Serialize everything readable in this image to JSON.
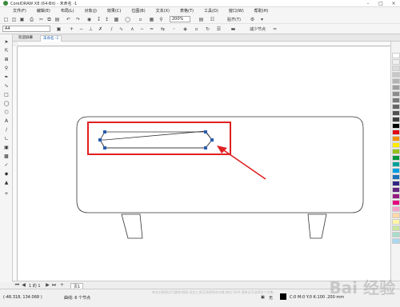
{
  "window": {
    "title": "CorelDRAW X8 (64-Bit) - 未命名 -1"
  },
  "menu": [
    "文件(F)",
    "编辑(E)",
    "布局(L)",
    "对象(J)",
    "效果(C)",
    "位图(B)",
    "文本(X)",
    "表格(T)",
    "工具(O)",
    "窗口(W)",
    "帮助(H)"
  ],
  "toolbar": {
    "zoom_value": "200%",
    "snap_label": "贴齐(T)",
    "font_value": "A4",
    "reduce_nodes_label": "减少节点"
  },
  "tabs": [
    "欢迎屏幕",
    "未命名 -1"
  ],
  "pagebar": {
    "page_counter": "1 的 1",
    "page_label": "页1"
  },
  "status": {
    "coords": "(-48.318, 134.068 )",
    "selection_info": "曲线 在 图层 1 上",
    "node_info": "曲线: 6 个节点",
    "hint": "单击对象两次可旋转/倾斜;双击工具可选择所有对象;按住 Shift 键单击可选择多个对象...",
    "fill_label": "无",
    "color_readout": "C:0 M:0 Y:0 K:100 .200 mm"
  },
  "watermark": "Bai 经验",
  "colors": {
    "highlight_red": "#e02020",
    "node_blue": "#2a5db0",
    "palette": [
      "#ffffff",
      "#f0f0f0",
      "#dcdcdc",
      "#c8c8c8",
      "#b4b4b4",
      "#a0a0a0",
      "#8c8c8c",
      "#787878",
      "#646464",
      "#505050",
      "#3c3c3c",
      "#000000",
      "#e30613",
      "#f39200",
      "#ffed00",
      "#95c11f",
      "#009640",
      "#00a19a",
      "#009fe3",
      "#1d71b8",
      "#312783",
      "#662483",
      "#951b81",
      "#e6007e",
      "#f5a3c7",
      "#fdd7a8",
      "#fff5a8",
      "#c8e6a0",
      "#a8dcc8",
      "#a8d8f0"
    ]
  }
}
